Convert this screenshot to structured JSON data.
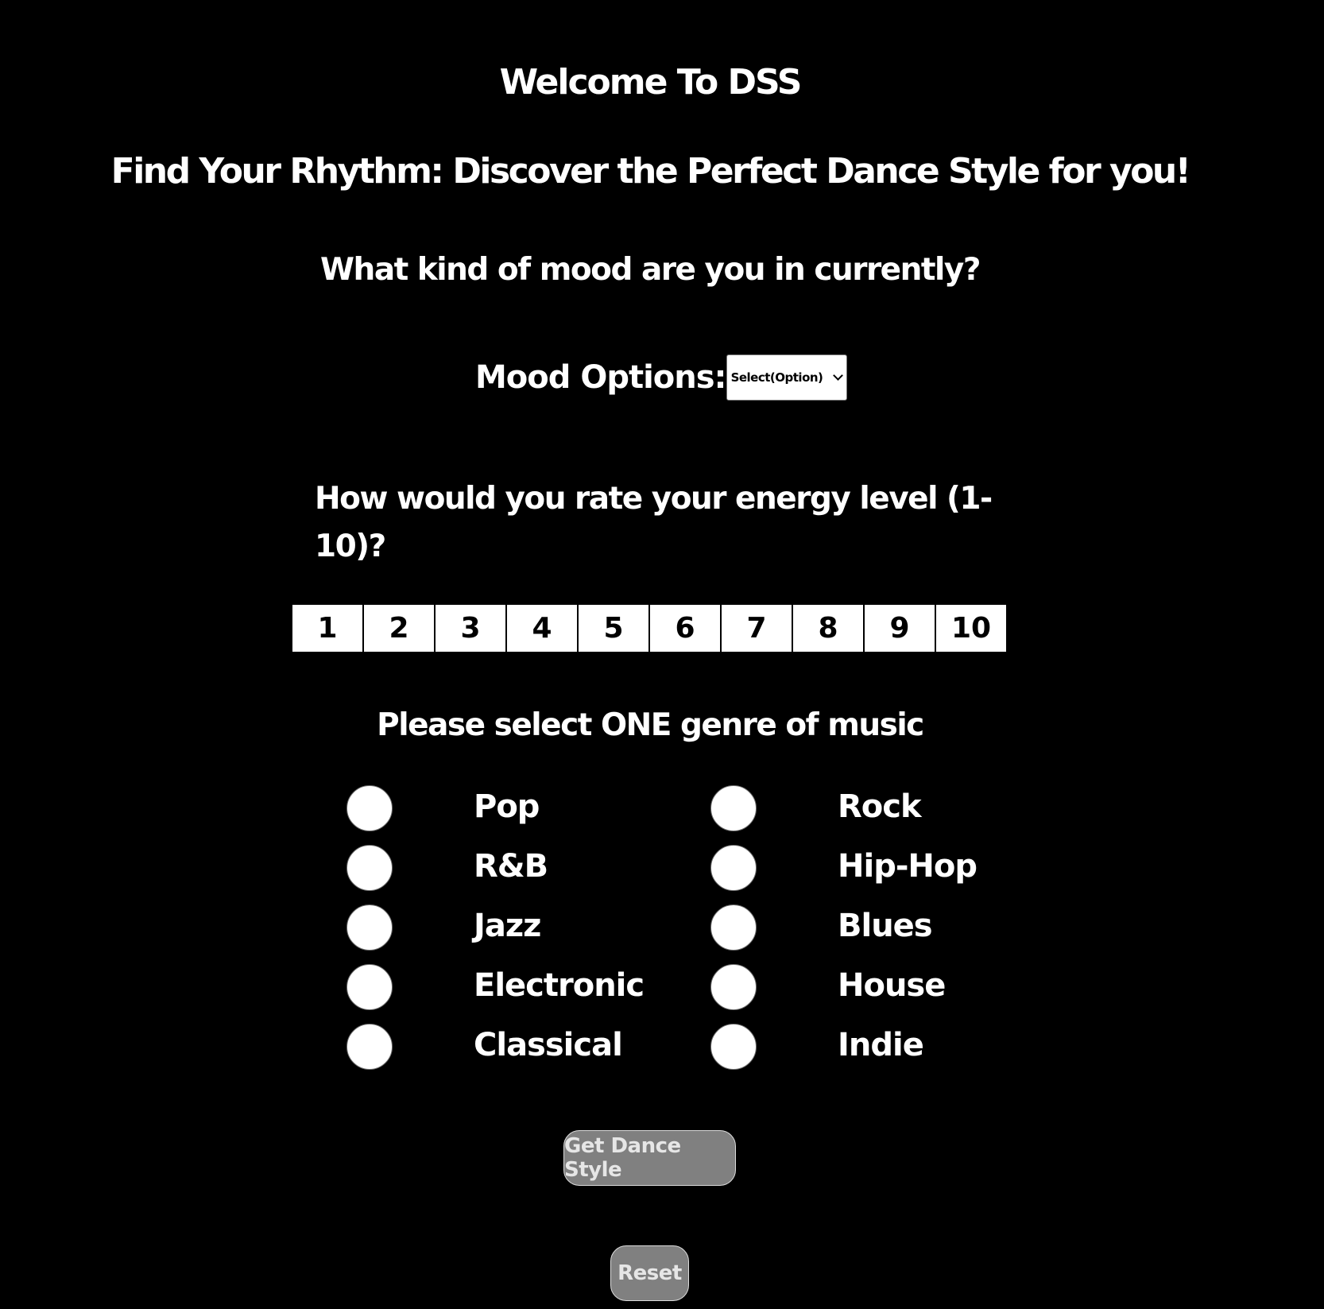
{
  "header": {
    "title": "Welcome To DSS",
    "subtitle": "Find Your Rhythm: Discover the Perfect Dance Style for you!"
  },
  "mood": {
    "question": "What kind of mood are you in currently?",
    "label": "Mood Options:",
    "selected": "Select(Option)"
  },
  "energy": {
    "question_line1": "How would you rate your energy level (1-",
    "question_line2": "10)?",
    "levels": [
      "1",
      "2",
      "3",
      "4",
      "5",
      "6",
      "7",
      "8",
      "9",
      "10"
    ]
  },
  "genre": {
    "question": "Please select ONE genre of music",
    "options": [
      "Pop",
      "Rock",
      "R&B",
      "Hip-Hop",
      "Jazz",
      "Blues",
      "Electronic",
      "House",
      "Classical",
      "Indie"
    ]
  },
  "actions": {
    "get_style": "Get Dance Style",
    "reset": "Reset"
  },
  "colors": {
    "background": "#000000",
    "text": "#ffffff",
    "button": "#808080"
  }
}
